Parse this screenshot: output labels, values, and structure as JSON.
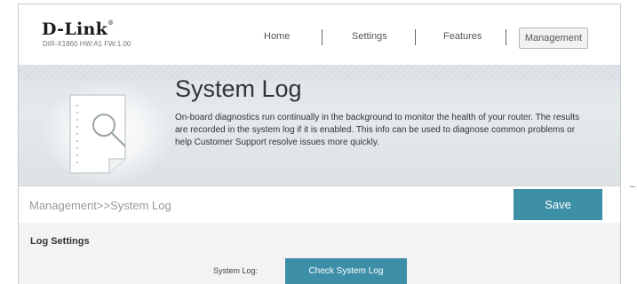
{
  "brand": {
    "logo": "D-Link",
    "model_info": "DIR-X1860 HW:A1 FW:1.00"
  },
  "nav": {
    "home": "Home",
    "settings": "Settings",
    "features": "Features",
    "management": "Management"
  },
  "hero": {
    "title": "System Log",
    "description": "On-board diagnostics run continually in the background to monitor the health of your router. The results are recorded in the system log if it is enabled. This info can be used to diagnose common problems or help Customer Support resolve issues more quickly."
  },
  "breadcrumb": "Management>>System Log",
  "save_label": "Save",
  "log_settings": {
    "title": "Log Settings",
    "system_log_label": "System Log:",
    "check_button": "Check System Log"
  },
  "colors": {
    "accent": "#3c8fa7"
  }
}
